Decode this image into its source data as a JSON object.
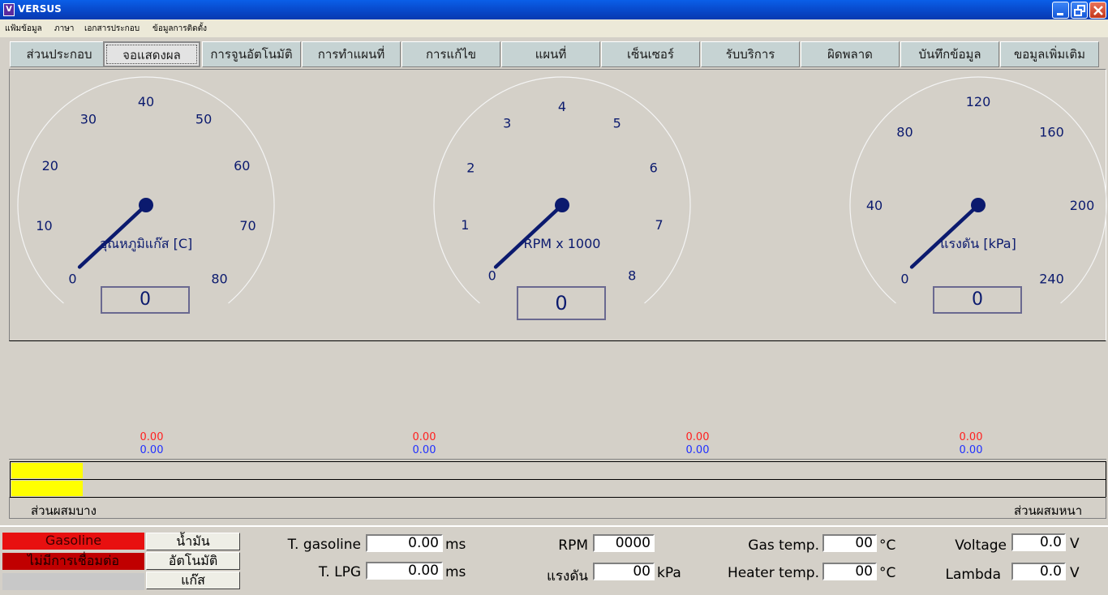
{
  "window": {
    "title": "VERSUS",
    "icon_glyph": "V"
  },
  "menu": [
    "แฟ้มข้อมูล",
    "ภาษา",
    "เอกสารประกอบ",
    "ข้อมูลการติดตั้ง"
  ],
  "tabs": [
    "ส่วนประกอบ",
    "จอแสดงผล",
    "การจูนอัตโนมัติ",
    "การทำแผนที่",
    "การแก้ไข",
    "แผนที่",
    "เซ็นเซอร์",
    "รับบริการ",
    "ผิดพลาด",
    "บันทึกข้อมูล",
    "ขอมูลเพิ่มเติม"
  ],
  "active_tab": "จอแสดงผล",
  "gauges": [
    {
      "label": "อุณหภูมิแก๊ส [C]",
      "ticks": [
        "0",
        "10",
        "20",
        "30",
        "40",
        "50",
        "60",
        "70",
        "80"
      ],
      "value": 0,
      "display": "0"
    },
    {
      "label": "RPM x 1000",
      "ticks": [
        "0",
        "1",
        "2",
        "3",
        "4",
        "5",
        "6",
        "7",
        "8"
      ],
      "value": 0,
      "display": "0"
    },
    {
      "label": "แรงดัน [kPa]",
      "ticks": [
        "0",
        "40",
        "80",
        "120",
        "160",
        "200",
        "240"
      ],
      "value": 0,
      "display": "0"
    }
  ],
  "readouts": [
    {
      "red": "0.00",
      "blue": "0.00"
    },
    {
      "red": "0.00",
      "blue": "0.00"
    },
    {
      "red": "0.00",
      "blue": "0.00"
    },
    {
      "red": "0.00",
      "blue": "0.00"
    }
  ],
  "mixture": {
    "lean": "ส่วนผสมบาง",
    "rich": "ส่วนผสมหนา",
    "bar1_level": 0.065,
    "bar2_level": 0.065
  },
  "status": {
    "fuel": "Gasoline",
    "connection": "ไม่มีการเชื่อมต่อ",
    "btn_petrol": "น้ำมัน",
    "btn_auto": "อัตโนมัติ",
    "btn_gas": "แก๊ส"
  },
  "fields": {
    "t_gasoline": {
      "label": "T. gasoline",
      "value": "0.00",
      "unit": "ms"
    },
    "t_lpg": {
      "label": "T. LPG",
      "value": "0.00",
      "unit": "ms"
    },
    "rpm": {
      "label": "RPM",
      "value": "0000",
      "unit": ""
    },
    "pressure": {
      "label": "แรงดัน",
      "value": "00",
      "unit": "kPa"
    },
    "gas_temp": {
      "label": "Gas temp.",
      "value": "00",
      "unit": "°C"
    },
    "heater_temp": {
      "label": "Heater temp.",
      "value": "00",
      "unit": "°C"
    },
    "voltage": {
      "label": "Voltage",
      "value": "0.0",
      "unit": "V"
    },
    "lambda": {
      "label": "Lambda",
      "value": "0.0",
      "unit": "V"
    }
  },
  "colors": {
    "gauge_ink": "#0b1a6e",
    "fuel_bg": "#e81010",
    "conn_bg": "#c00000",
    "mix_fill": "#ffff00"
  }
}
